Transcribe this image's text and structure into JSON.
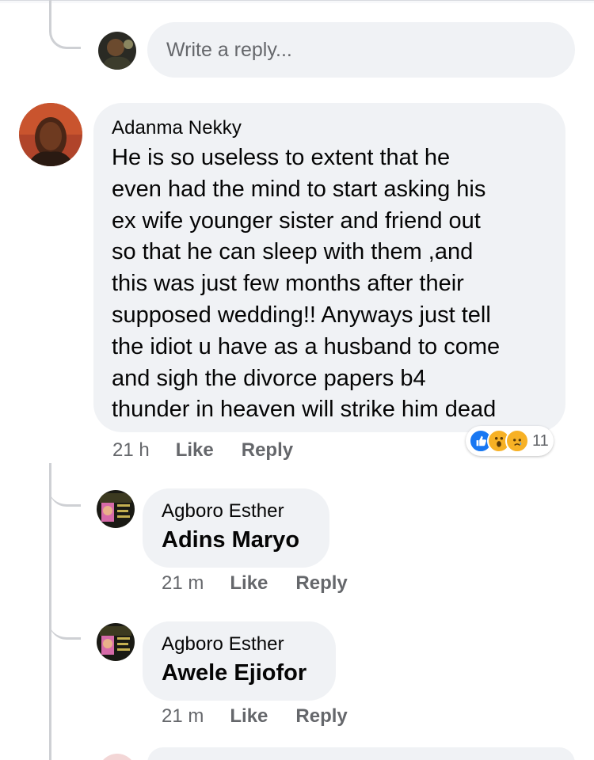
{
  "reply_box": {
    "placeholder": "Write a reply..."
  },
  "comment": {
    "author": "Adanma Nekky",
    "lines": [
      "He is so useless to extent  that he",
      "even had the mind to start asking his",
      "ex wife younger sister and friend out",
      "so that he can sleep with them ,and",
      "this was just few months after their",
      "supposed wedding!! Anyways just tell",
      "the idiot u have as a husband to come",
      "and sigh the divorce papers b4",
      "thunder in heaven will strike him dead"
    ],
    "time": "21 h",
    "like_label": "Like",
    "reply_label": "Reply",
    "reactions": {
      "icons": [
        "like-reaction-icon",
        "wow-reaction-icon",
        "sad-reaction-icon"
      ],
      "count": "11",
      "colors": {
        "like": "#1877f2",
        "wow": "#f7b125",
        "sad": "#f7b125"
      }
    }
  },
  "replies": [
    {
      "author": "Agboro Esther",
      "text": "Adins Maryo",
      "time": "21 m",
      "like_label": "Like",
      "reply_label": "Reply"
    },
    {
      "author": "Agboro Esther",
      "text": "Awele Ejiofor",
      "time": "21 m",
      "like_label": "Like",
      "reply_label": "Reply"
    }
  ]
}
